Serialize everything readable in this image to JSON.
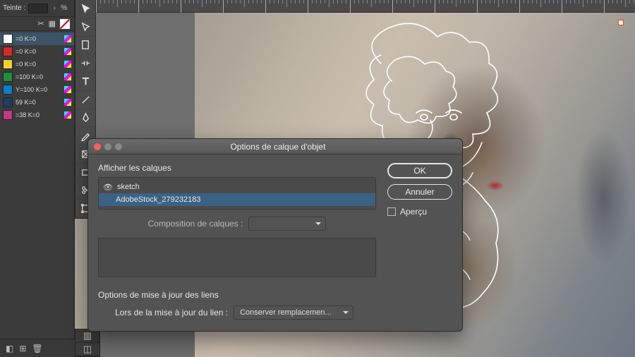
{
  "tint": {
    "label": "Teinte :",
    "value": "",
    "percent": "%"
  },
  "swatches": [
    {
      "label": "=0 K=0",
      "color": "#ffffff",
      "selected": true
    },
    {
      "label": "=0 K=0",
      "color": "#d9282a"
    },
    {
      "label": "=0 K=0",
      "color": "#f3d12a"
    },
    {
      "label": "=100 K=0",
      "color": "#1f8f3b"
    },
    {
      "label": "Y=100 K=0",
      "color": "#0a7fc4"
    },
    {
      "label": "59 K=0",
      "color": "#1d3c66"
    },
    {
      "label": "=38 K=0",
      "color": "#c03a84"
    }
  ],
  "tools": [
    "selection",
    "direct-selection",
    "page",
    "gap",
    "content-collector",
    "type",
    "line",
    "pen",
    "pencil",
    "rectangle",
    "scissors",
    "free-transform"
  ],
  "dialog": {
    "title": "Options de calque d'objet",
    "show_layers_label": "Afficher les calques",
    "layers": [
      "sketch",
      "AdobeStock_279232183"
    ],
    "selected_layer_index": 1,
    "comp_label": "Composition de calques :",
    "comp_value": "",
    "link_section_label": "Options de mise à jour des liens",
    "link_update_label": "Lors de la mise à jour du lien :",
    "link_update_value": "Conserver remplacemen...",
    "ok": "OK",
    "cancel": "Annuler",
    "preview": "Aperçu"
  }
}
